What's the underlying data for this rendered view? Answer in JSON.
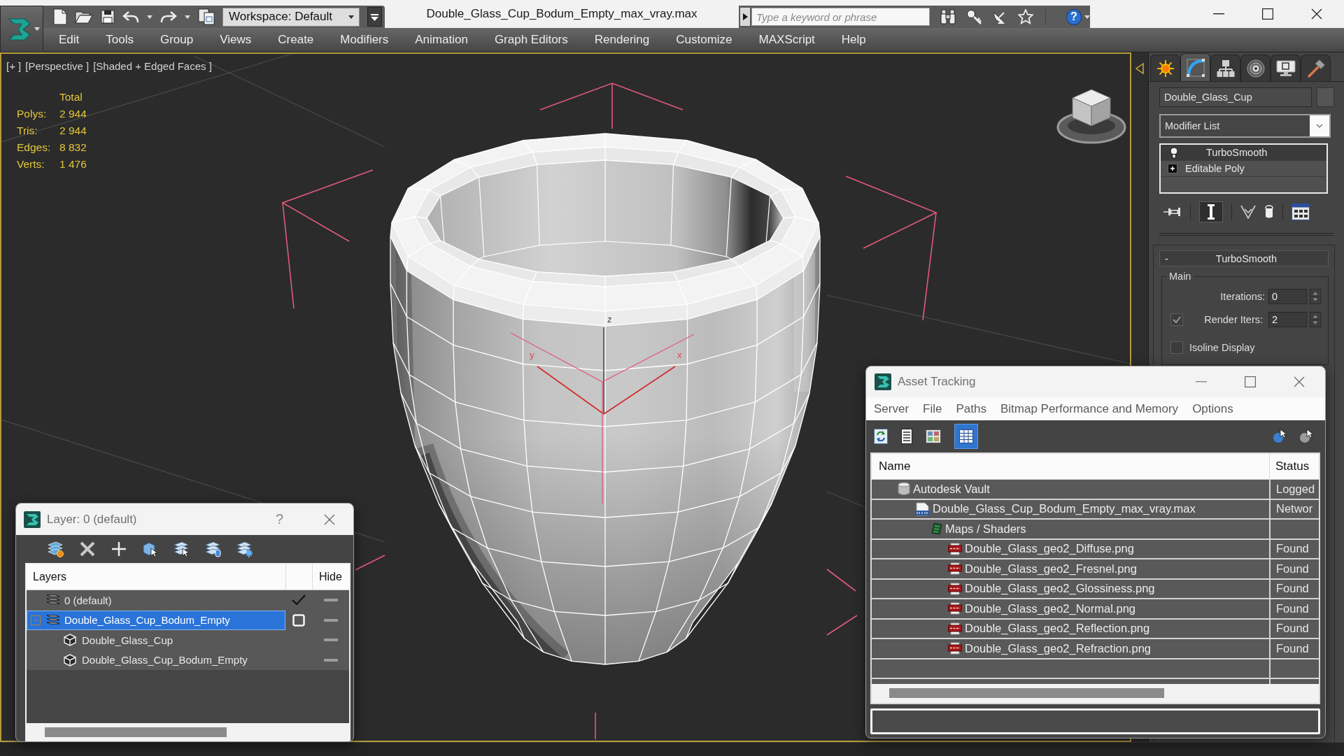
{
  "title_bar": {
    "workspace": "Workspace: Default",
    "title": "Double_Glass_Cup_Bodum_Empty_max_vray.max",
    "search_placeholder": "Type a keyword or phrase",
    "help": "?"
  },
  "menu": [
    "Edit",
    "Tools",
    "Group",
    "Views",
    "Create",
    "Modifiers",
    "Animation",
    "Graph Editors",
    "Rendering",
    "Customize",
    "MAXScript",
    "Help"
  ],
  "viewport": {
    "labels": [
      "[+ ]",
      "[Perspective ]",
      "[Shaded + Edged Faces ]"
    ],
    "stats_heading": "Total",
    "stats": [
      {
        "label": "Polys:",
        "value": "2 944"
      },
      {
        "label": "Tris:",
        "value": "2 944"
      },
      {
        "label": "Edges:",
        "value": "8 832"
      },
      {
        "label": "Verts:",
        "value": "1 476"
      }
    ],
    "axis_labels": [
      "z",
      "y",
      "x"
    ]
  },
  "command_panel": {
    "tabs": [
      {
        "kind": "create",
        "selected": false
      },
      {
        "kind": "modify",
        "selected": true
      },
      {
        "kind": "hierarchy",
        "selected": false
      },
      {
        "kind": "motion",
        "selected": false
      },
      {
        "kind": "display",
        "selected": false
      },
      {
        "kind": "utilities",
        "selected": false
      }
    ],
    "object_name": "Double_Glass_Cup",
    "modifier_list": "Modifier List",
    "stack": [
      {
        "name": "TurboSmooth",
        "kind": "modifier",
        "selected": true
      },
      {
        "name": "Editable Poly",
        "kind": "base",
        "selected": false
      }
    ],
    "stack_buttons": [
      {
        "kind": "pin",
        "on": false
      },
      {
        "kind": "end-result",
        "on": true
      },
      {
        "kind": "make-unique",
        "on": false
      },
      {
        "kind": "remove",
        "on": false
      },
      {
        "kind": "configure",
        "on": false
      }
    ],
    "rollout": {
      "sign": "-",
      "title": "TurboSmooth",
      "group": "Main",
      "fields": [
        {
          "kind": "spinner",
          "label": "Iterations:",
          "value": "0"
        },
        {
          "kind": "check-spinner",
          "label": "Render Iters:",
          "value": "2",
          "checked": true
        },
        {
          "kind": "checkbox",
          "label": "Isoline Display",
          "checked": false
        }
      ]
    }
  },
  "layer_dialog": {
    "title": "Layer: 0 (default)",
    "help": "?",
    "columns": [
      "Layers",
      "Hide"
    ],
    "layers": [
      {
        "name": "0 (default)",
        "kind": "layer",
        "current": true,
        "selected": false
      },
      {
        "name": "Double_Glass_Cup_Bodum_Empty",
        "kind": "layer",
        "current": false,
        "selected": true,
        "expanded": true,
        "children": [
          {
            "name": "Double_Glass_Cup",
            "kind": "object",
            "selected": false
          },
          {
            "name": "Double_Glass_Cup_Bodum_Empty",
            "kind": "object",
            "selected": false
          }
        ]
      }
    ]
  },
  "asset_tracking": {
    "title": "Asset Tracking",
    "menu": [
      "Server",
      "File",
      "Paths",
      "Bitmap Performance and Memory",
      "Options"
    ],
    "toolbar": [
      {
        "kind": "refresh",
        "selected": false
      },
      {
        "kind": "list",
        "selected": false
      },
      {
        "kind": "thumbnails",
        "selected": false
      },
      {
        "kind": "table",
        "selected": true
      }
    ],
    "columns": [
      "Name",
      "Status"
    ],
    "tree": [
      {
        "name": "Autodesk Vault",
        "kind": "vault",
        "status": "Logged",
        "children": [
          {
            "name": "Double_Glass_Cup_Bodum_Empty_max_vray.max",
            "kind": "max",
            "status": "Networ",
            "children": [
              {
                "name": "Maps / Shaders",
                "kind": "maps",
                "children": [
                  {
                    "name": "Double_Glass_geo2_Diffuse.png",
                    "kind": "png",
                    "status": "Found"
                  },
                  {
                    "name": "Double_Glass_geo2_Fresnel.png",
                    "kind": "png",
                    "status": "Found"
                  },
                  {
                    "name": "Double_Glass_geo2_Glossiness.png",
                    "kind": "png",
                    "status": "Found"
                  },
                  {
                    "name": "Double_Glass_geo2_Normal.png",
                    "kind": "png",
                    "status": "Found"
                  },
                  {
                    "name": "Double_Glass_geo2_Reflection.png",
                    "kind": "png",
                    "status": "Found"
                  },
                  {
                    "name": "Double_Glass_geo2_Refraction.png",
                    "kind": "png",
                    "status": "Found"
                  }
                ]
              }
            ]
          }
        ]
      }
    ]
  }
}
